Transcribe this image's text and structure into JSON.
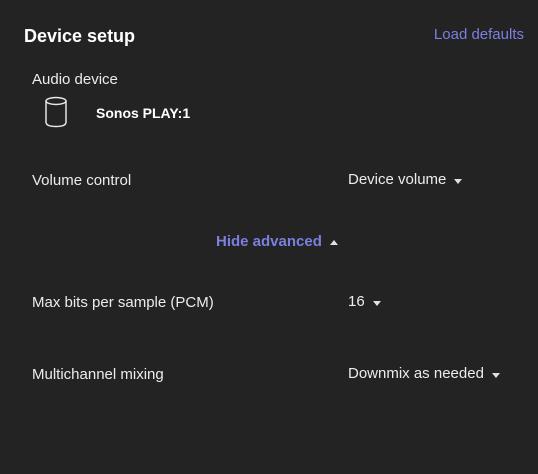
{
  "header": {
    "title": "Device setup",
    "load_defaults_label": "Load defaults"
  },
  "audio_device": {
    "label": "Audio device",
    "device_name": "Sonos PLAY:1",
    "icon": "speaker-icon"
  },
  "volume_control": {
    "label": "Volume control",
    "selected": "Device volume"
  },
  "advanced_toggle": {
    "label": "Hide advanced",
    "accent": "#7b7fe0"
  },
  "max_bits": {
    "label": "Max bits per sample (PCM)",
    "selected": "16"
  },
  "multichannel": {
    "label": "Multichannel mixing",
    "selected": "Downmix as needed"
  },
  "colors": {
    "background": "#232323",
    "text": "#ececec",
    "accent": "#7b7fe0"
  }
}
